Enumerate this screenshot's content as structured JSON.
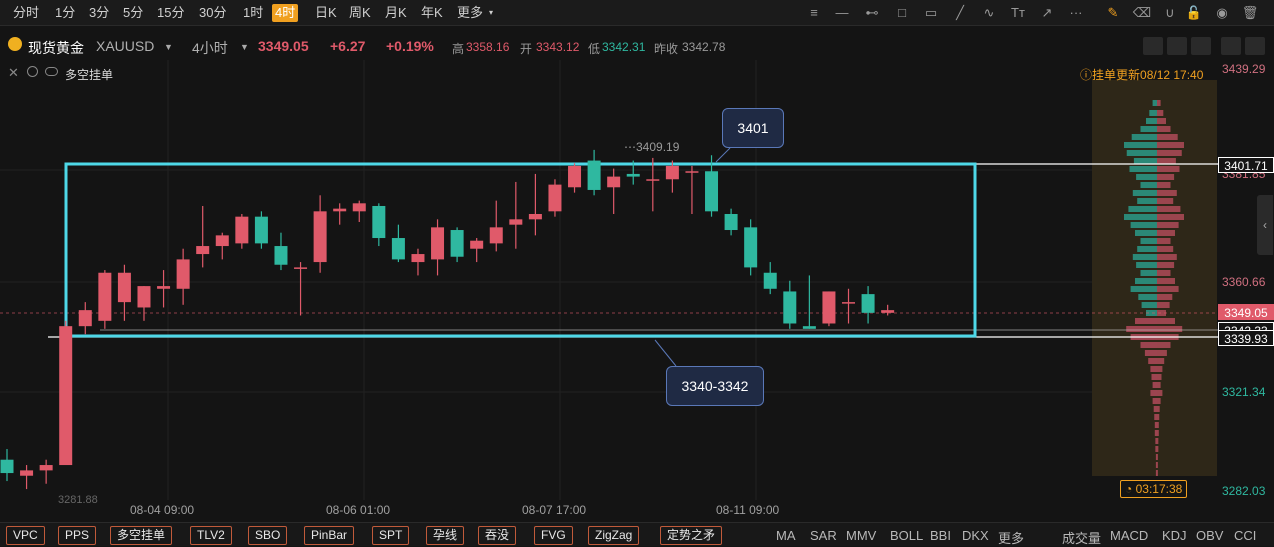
{
  "timeframes": [
    {
      "label": "分时",
      "active": false
    },
    {
      "label": "1分",
      "active": false
    },
    {
      "label": "3分",
      "active": false
    },
    {
      "label": "5分",
      "active": false
    },
    {
      "label": "15分",
      "active": false
    },
    {
      "label": "30分",
      "active": false
    },
    {
      "label": "1时",
      "active": false
    },
    {
      "label": "4时",
      "active": true
    },
    {
      "label": "日K",
      "active": false
    },
    {
      "label": "周K",
      "active": false
    },
    {
      "label": "月K",
      "active": false
    },
    {
      "label": "年K",
      "active": false
    },
    {
      "label": "更多",
      "active": false
    }
  ],
  "toolbar_icons": [
    "fibonacci-icon",
    "horizontal-line-icon",
    "horizontal-ray-icon",
    "rectangle-icon",
    "comment-icon",
    "trendline-icon",
    "wave-icon",
    "text-icon",
    "arrow-icon",
    "more-dots-icon",
    "edit-icon",
    "eraser-icon",
    "magnet-icon",
    "unlock-icon",
    "eye-icon",
    "trash-icon"
  ],
  "symbol": {
    "name": "现货黄金",
    "code": "XAUUSD",
    "interval": "4小时",
    "price": "3349.05",
    "change": "+6.27",
    "change_pct": "+0.19%",
    "high_label": "高",
    "high": "3358.16",
    "open_label": "开",
    "open": "3343.12",
    "low_label": "低",
    "low": "3342.31",
    "prev_label": "昨收",
    "prev": "3342.78"
  },
  "overlay_label": "多空挂单",
  "orderbook_update": "挂单更新08/12 17:40",
  "price_axis": {
    "labels": [
      "3439.29",
      "3381.85",
      "3360.66",
      "3321.34",
      "3282.03"
    ],
    "boxes": [
      {
        "text": "3401.71",
        "fg": "#ffffff",
        "bg": "#141414",
        "border": "#ffffff"
      },
      {
        "text": "3349.05",
        "fg": "#ffffff",
        "bg": "#e05a6a",
        "border": "#e05a6a"
      },
      {
        "text": "3342.33",
        "fg": "#ffffff",
        "bg": "#141414",
        "border": "#ffffff"
      },
      {
        "text": "3339.93",
        "fg": "#ffffff",
        "bg": "#141414",
        "border": "#ffffff"
      }
    ]
  },
  "x_labels": [
    "08-04 09:00",
    "08-06 01:00",
    "08-07 17:00",
    "08-11 09:00"
  ],
  "timer": "03:17:38",
  "peak_label": "3409.19",
  "low_marker": "3281.88",
  "callouts": {
    "top": "3401",
    "bottom": "3340-3342"
  },
  "indicators": [
    "VPC",
    "PPS",
    "多空挂单",
    "TLV2",
    "SBO",
    "PinBar",
    "SPT",
    "孕线",
    "吞没",
    "FVG",
    "ZigZag",
    "定势之矛"
  ],
  "indicators2": [
    "MA",
    "SAR",
    "MMV",
    "BOLL",
    "BBI",
    "DKX",
    "更多",
    "成交量",
    "MACD",
    "KDJ",
    "OBV",
    "CCI"
  ],
  "colors": {
    "up": "#e05a6a",
    "down": "#2fb8a0",
    "box": "#4ed8e8",
    "accent": "#f0a020"
  },
  "chart_data": {
    "type": "candlestick",
    "ylim": [
      3282.03,
      3439.29
    ],
    "candles": [
      {
        "o": 3293,
        "h": 3297,
        "l": 3285,
        "c": 3288
      },
      {
        "o": 3287,
        "h": 3291,
        "l": 3282,
        "c": 3289
      },
      {
        "o": 3289,
        "h": 3293,
        "l": 3284,
        "c": 3291
      },
      {
        "o": 3291,
        "h": 3345,
        "l": 3291,
        "c": 3343
      },
      {
        "o": 3343,
        "h": 3352,
        "l": 3340,
        "c": 3349
      },
      {
        "o": 3345,
        "h": 3364,
        "l": 3342,
        "c": 3363
      },
      {
        "o": 3352,
        "h": 3366,
        "l": 3345,
        "c": 3363
      },
      {
        "o": 3350,
        "h": 3358,
        "l": 3345,
        "c": 3358
      },
      {
        "o": 3357,
        "h": 3364,
        "l": 3350,
        "c": 3358
      },
      {
        "o": 3357,
        "h": 3372,
        "l": 3351,
        "c": 3368
      },
      {
        "o": 3370,
        "h": 3388,
        "l": 3365,
        "c": 3373
      },
      {
        "o": 3373,
        "h": 3378,
        "l": 3368,
        "c": 3377
      },
      {
        "o": 3374,
        "h": 3385,
        "l": 3372,
        "c": 3384
      },
      {
        "o": 3384,
        "h": 3386,
        "l": 3372,
        "c": 3374
      },
      {
        "o": 3373,
        "h": 3378,
        "l": 3364,
        "c": 3366
      },
      {
        "o": 3365,
        "h": 3367,
        "l": 3347,
        "c": 3365
      },
      {
        "o": 3367,
        "h": 3392,
        "l": 3363,
        "c": 3386
      },
      {
        "o": 3386,
        "h": 3389,
        "l": 3381,
        "c": 3387
      },
      {
        "o": 3386,
        "h": 3390,
        "l": 3382,
        "c": 3389
      },
      {
        "o": 3388,
        "h": 3389,
        "l": 3373,
        "c": 3376
      },
      {
        "o": 3376,
        "h": 3381,
        "l": 3367,
        "c": 3368
      },
      {
        "o": 3367,
        "h": 3372,
        "l": 3362,
        "c": 3370
      },
      {
        "o": 3368,
        "h": 3383,
        "l": 3362,
        "c": 3380
      },
      {
        "o": 3379,
        "h": 3380,
        "l": 3367,
        "c": 3369
      },
      {
        "o": 3372,
        "h": 3376,
        "l": 3367,
        "c": 3375
      },
      {
        "o": 3374,
        "h": 3390,
        "l": 3371,
        "c": 3380
      },
      {
        "o": 3381,
        "h": 3397,
        "l": 3372,
        "c": 3383
      },
      {
        "o": 3383,
        "h": 3400,
        "l": 3377,
        "c": 3385
      },
      {
        "o": 3386,
        "h": 3398,
        "l": 3384,
        "c": 3396
      },
      {
        "o": 3395,
        "h": 3404,
        "l": 3393,
        "c": 3403
      },
      {
        "o": 3405,
        "h": 3409,
        "l": 3392,
        "c": 3394
      },
      {
        "o": 3395,
        "h": 3402,
        "l": 3385,
        "c": 3399
      },
      {
        "o": 3400,
        "h": 3405,
        "l": 3396,
        "c": 3399
      },
      {
        "o": 3398,
        "h": 3406,
        "l": 3386,
        "c": 3398
      },
      {
        "o": 3398,
        "h": 3405,
        "l": 3393,
        "c": 3403
      },
      {
        "o": 3401,
        "h": 3403,
        "l": 3385,
        "c": 3401
      },
      {
        "o": 3401,
        "h": 3407,
        "l": 3384,
        "c": 3386
      },
      {
        "o": 3385,
        "h": 3387,
        "l": 3377,
        "c": 3379
      },
      {
        "o": 3380,
        "h": 3383,
        "l": 3362,
        "c": 3365
      },
      {
        "o": 3363,
        "h": 3367,
        "l": 3355,
        "c": 3357
      },
      {
        "o": 3356,
        "h": 3360,
        "l": 3342,
        "c": 3344
      },
      {
        "o": 3343,
        "h": 3362,
        "l": 3342,
        "c": 3342
      },
      {
        "o": 3344,
        "h": 3356,
        "l": 3343,
        "c": 3356
      },
      {
        "o": 3352,
        "h": 3357,
        "l": 3344,
        "c": 3352
      },
      {
        "o": 3355,
        "h": 3358,
        "l": 3344,
        "c": 3348
      },
      {
        "o": 3348,
        "h": 3351,
        "l": 3347,
        "c": 3349
      }
    ]
  }
}
